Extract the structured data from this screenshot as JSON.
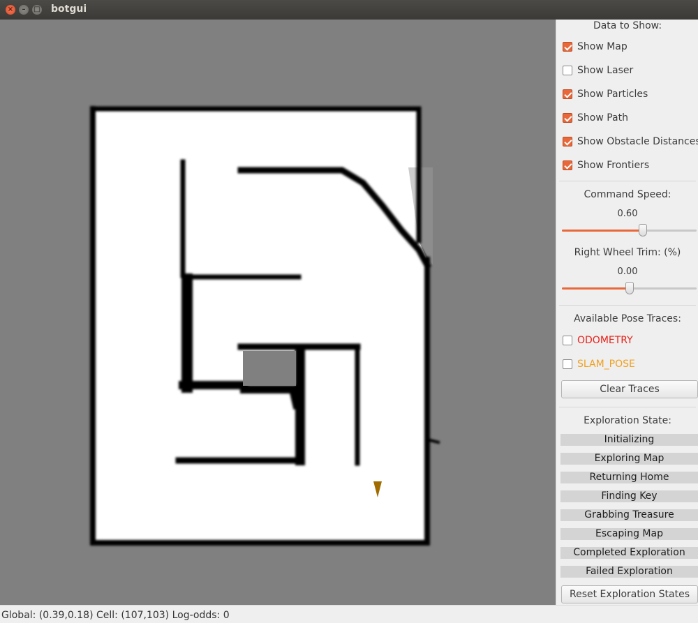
{
  "window": {
    "title": "botgui",
    "close_glyph": "×",
    "min_glyph": "–",
    "max_glyph": "□"
  },
  "sidebar": {
    "data_title": "Data to Show:",
    "checkboxes": [
      {
        "label": "Show Map",
        "checked": true
      },
      {
        "label": "Show Laser",
        "checked": false
      },
      {
        "label": "Show Particles",
        "checked": true
      },
      {
        "label": "Show Path",
        "checked": true
      },
      {
        "label": "Show Obstacle Distances",
        "checked": true
      },
      {
        "label": "Show Frontiers",
        "checked": true
      }
    ],
    "command_speed": {
      "label": "Command Speed:",
      "value": "0.60",
      "fraction": 0.6
    },
    "wheel_trim": {
      "label": "Right Wheel Trim: (%)",
      "value": "0.00",
      "fraction": 0.5
    },
    "pose_title": "Available Pose Traces:",
    "pose_traces": [
      {
        "label": "ODOMETRY",
        "checked": false,
        "color": "#e8221a"
      },
      {
        "label": "SLAM_POSE",
        "checked": false,
        "color": "#f0a020"
      }
    ],
    "clear_traces": "Clear Traces",
    "exploration_title": "Exploration State:",
    "states": [
      "Initializing",
      "Exploring Map",
      "Returning Home",
      "Finding Key",
      "Grabbing Treasure",
      "Escaping Map",
      "Completed Exploration",
      "Failed Exploration"
    ],
    "reset_button": "Reset Exploration States"
  },
  "status": {
    "text": "Global: (0.39,0.18) Cell: (107,103) Log-odds: 0"
  },
  "colors": {
    "accent": "#e9683a",
    "map_unknown": "#808080",
    "map_free": "#ffffff",
    "map_wall": "#000000",
    "robot": "#a06c00"
  }
}
